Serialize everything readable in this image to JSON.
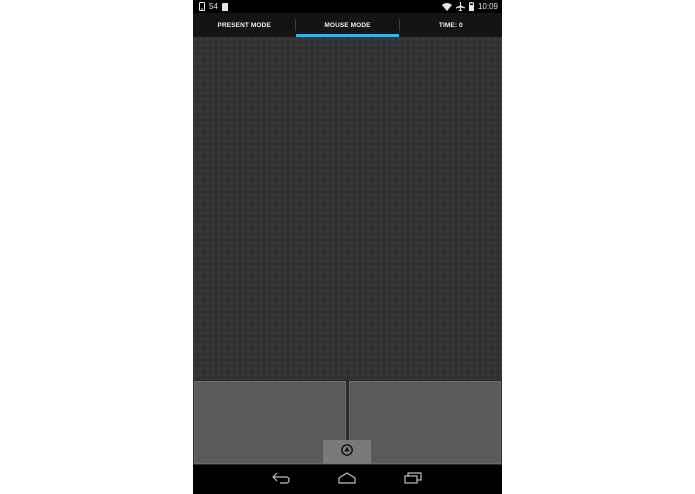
{
  "status_bar": {
    "notification_count": "54",
    "time": "10:09",
    "icons": [
      "phone-icon",
      "sd-card-icon",
      "wifi-icon",
      "airplane-mode-icon",
      "battery-icon"
    ]
  },
  "tabs": [
    {
      "label": "PRESENT MODE",
      "active": false
    },
    {
      "label": "MOUSE MODE",
      "active": true
    },
    {
      "label": "TIME: 0",
      "active": false
    }
  ],
  "colors": {
    "accent": "#33b5e5",
    "background": "#333333",
    "button": "#5a5a5a"
  },
  "navigation": [
    "back-icon",
    "home-icon",
    "recents-icon"
  ]
}
